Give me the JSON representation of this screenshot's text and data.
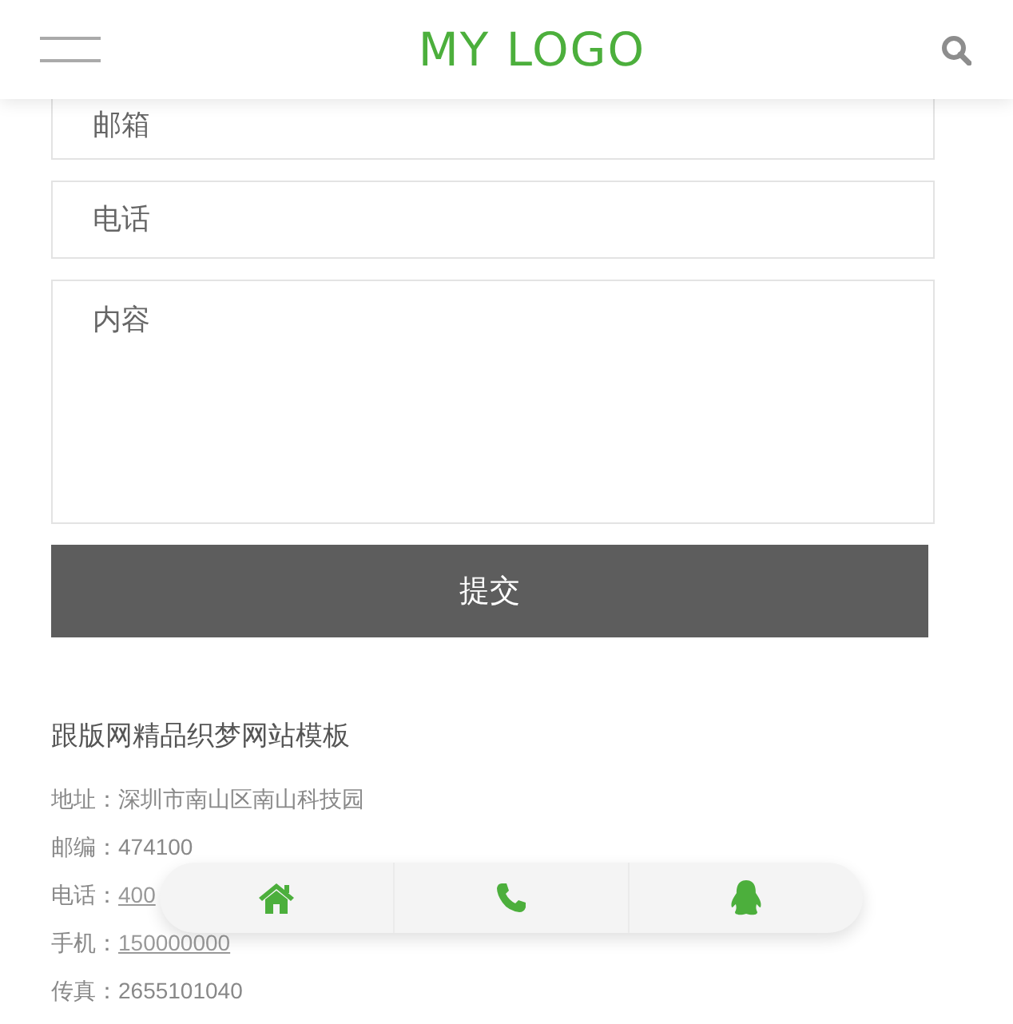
{
  "header": {
    "logo": "MY LOGO"
  },
  "form": {
    "fields": [
      {
        "kind": "input",
        "placeholder": "邮箱"
      },
      {
        "kind": "input",
        "placeholder": "电话"
      },
      {
        "kind": "textarea",
        "placeholder": "内容"
      }
    ],
    "submit": "提交"
  },
  "contact": {
    "title": "跟版网精品织梦网站模板",
    "lines": [
      {
        "label": "地址：",
        "value": "深圳市南山区南山科技园",
        "link": false
      },
      {
        "label": "邮编：",
        "value": "474100",
        "link": false
      },
      {
        "label": "电话：",
        "value": "400",
        "link": true
      },
      {
        "label": "手机：",
        "value": "150000000",
        "link": true
      },
      {
        "label": "传真：",
        "value": "2655101040",
        "link": false
      }
    ]
  },
  "bottom_bar": [
    {
      "kind": "home"
    },
    {
      "kind": "phone"
    },
    {
      "kind": "qq"
    }
  ]
}
